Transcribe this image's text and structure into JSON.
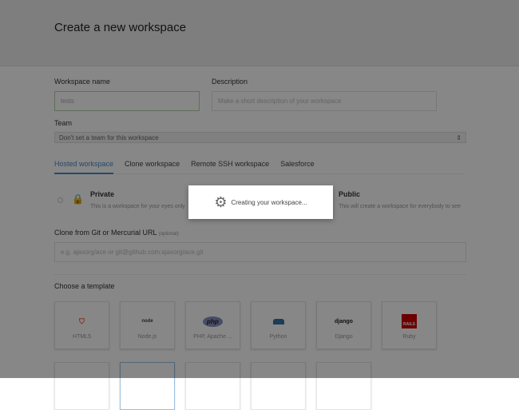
{
  "header": {
    "title": "Create a new workspace"
  },
  "form": {
    "name_label": "Workspace name",
    "name_value": "tests",
    "desc_label": "Description",
    "desc_placeholder": "Make a short description of your workspace",
    "team_label": "Team",
    "team_value": "Don't set a team for this workspace",
    "tabs": [
      {
        "label": "Hosted workspace",
        "active": true
      },
      {
        "label": "Clone workspace"
      },
      {
        "label": "Remote SSH workspace"
      },
      {
        "label": "Salesforce"
      }
    ],
    "private": {
      "title": "Private",
      "desc": "This is a workspace for your eyes only"
    },
    "public": {
      "title": "Public",
      "desc": "This will create a workspace for everybody to see"
    },
    "clone_label": "Clone from Git or Mercurial URL",
    "clone_optional": "(optional)",
    "clone_placeholder": "e.g. ajaxorg/ace or git@github.com:ajaxorg/ace.git",
    "template_label": "Choose a template",
    "templates": [
      {
        "label": "HTML5",
        "logo": "HTML 5"
      },
      {
        "label": "Node.js",
        "logo": "node"
      },
      {
        "label": "PHP, Apache ...",
        "logo": "php"
      },
      {
        "label": "Python",
        "logo": "python"
      },
      {
        "label": "Django",
        "logo": "django"
      },
      {
        "label": "Ruby",
        "logo": "RAILS"
      }
    ]
  },
  "modal": {
    "text": "Creating your workspace...",
    "icon": "gear-icon"
  }
}
